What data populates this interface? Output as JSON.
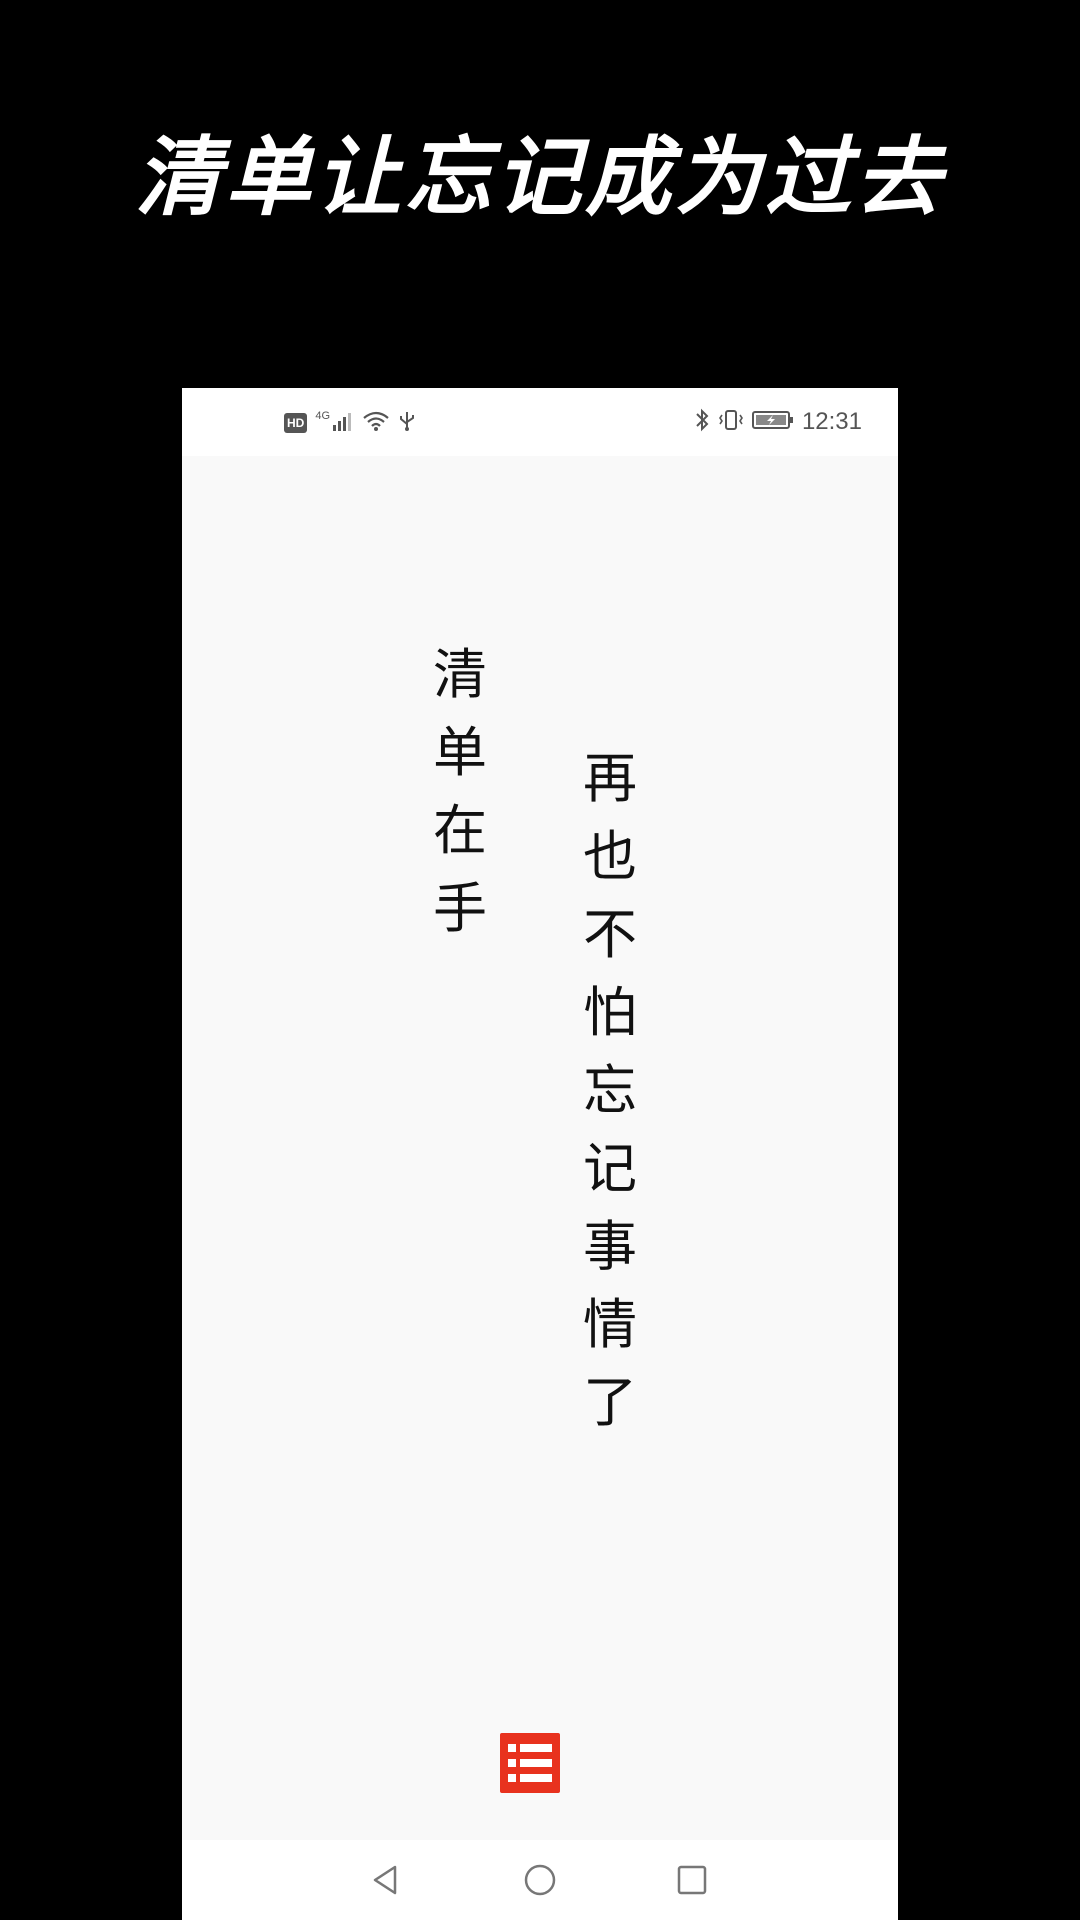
{
  "headline": "清单让忘记成为过去",
  "status_bar": {
    "hd": "HD",
    "network": "4G",
    "time": "12:31"
  },
  "slogan": {
    "line1": "清单在手",
    "line2": "再也不怕忘记事情了"
  },
  "icons": {
    "signal": "signal-icon",
    "wifi": "wifi-icon",
    "usb": "usb-icon",
    "bluetooth": "bluetooth-icon",
    "vibrate": "vibrate-icon",
    "battery": "battery-icon",
    "app_logo": "checklist-icon",
    "nav_back": "back-triangle-icon",
    "nav_home": "home-circle-icon",
    "nav_recent": "recent-square-icon"
  },
  "colors": {
    "accent": "#e8321e",
    "background": "#000000",
    "screen": "#f9f9f9"
  }
}
